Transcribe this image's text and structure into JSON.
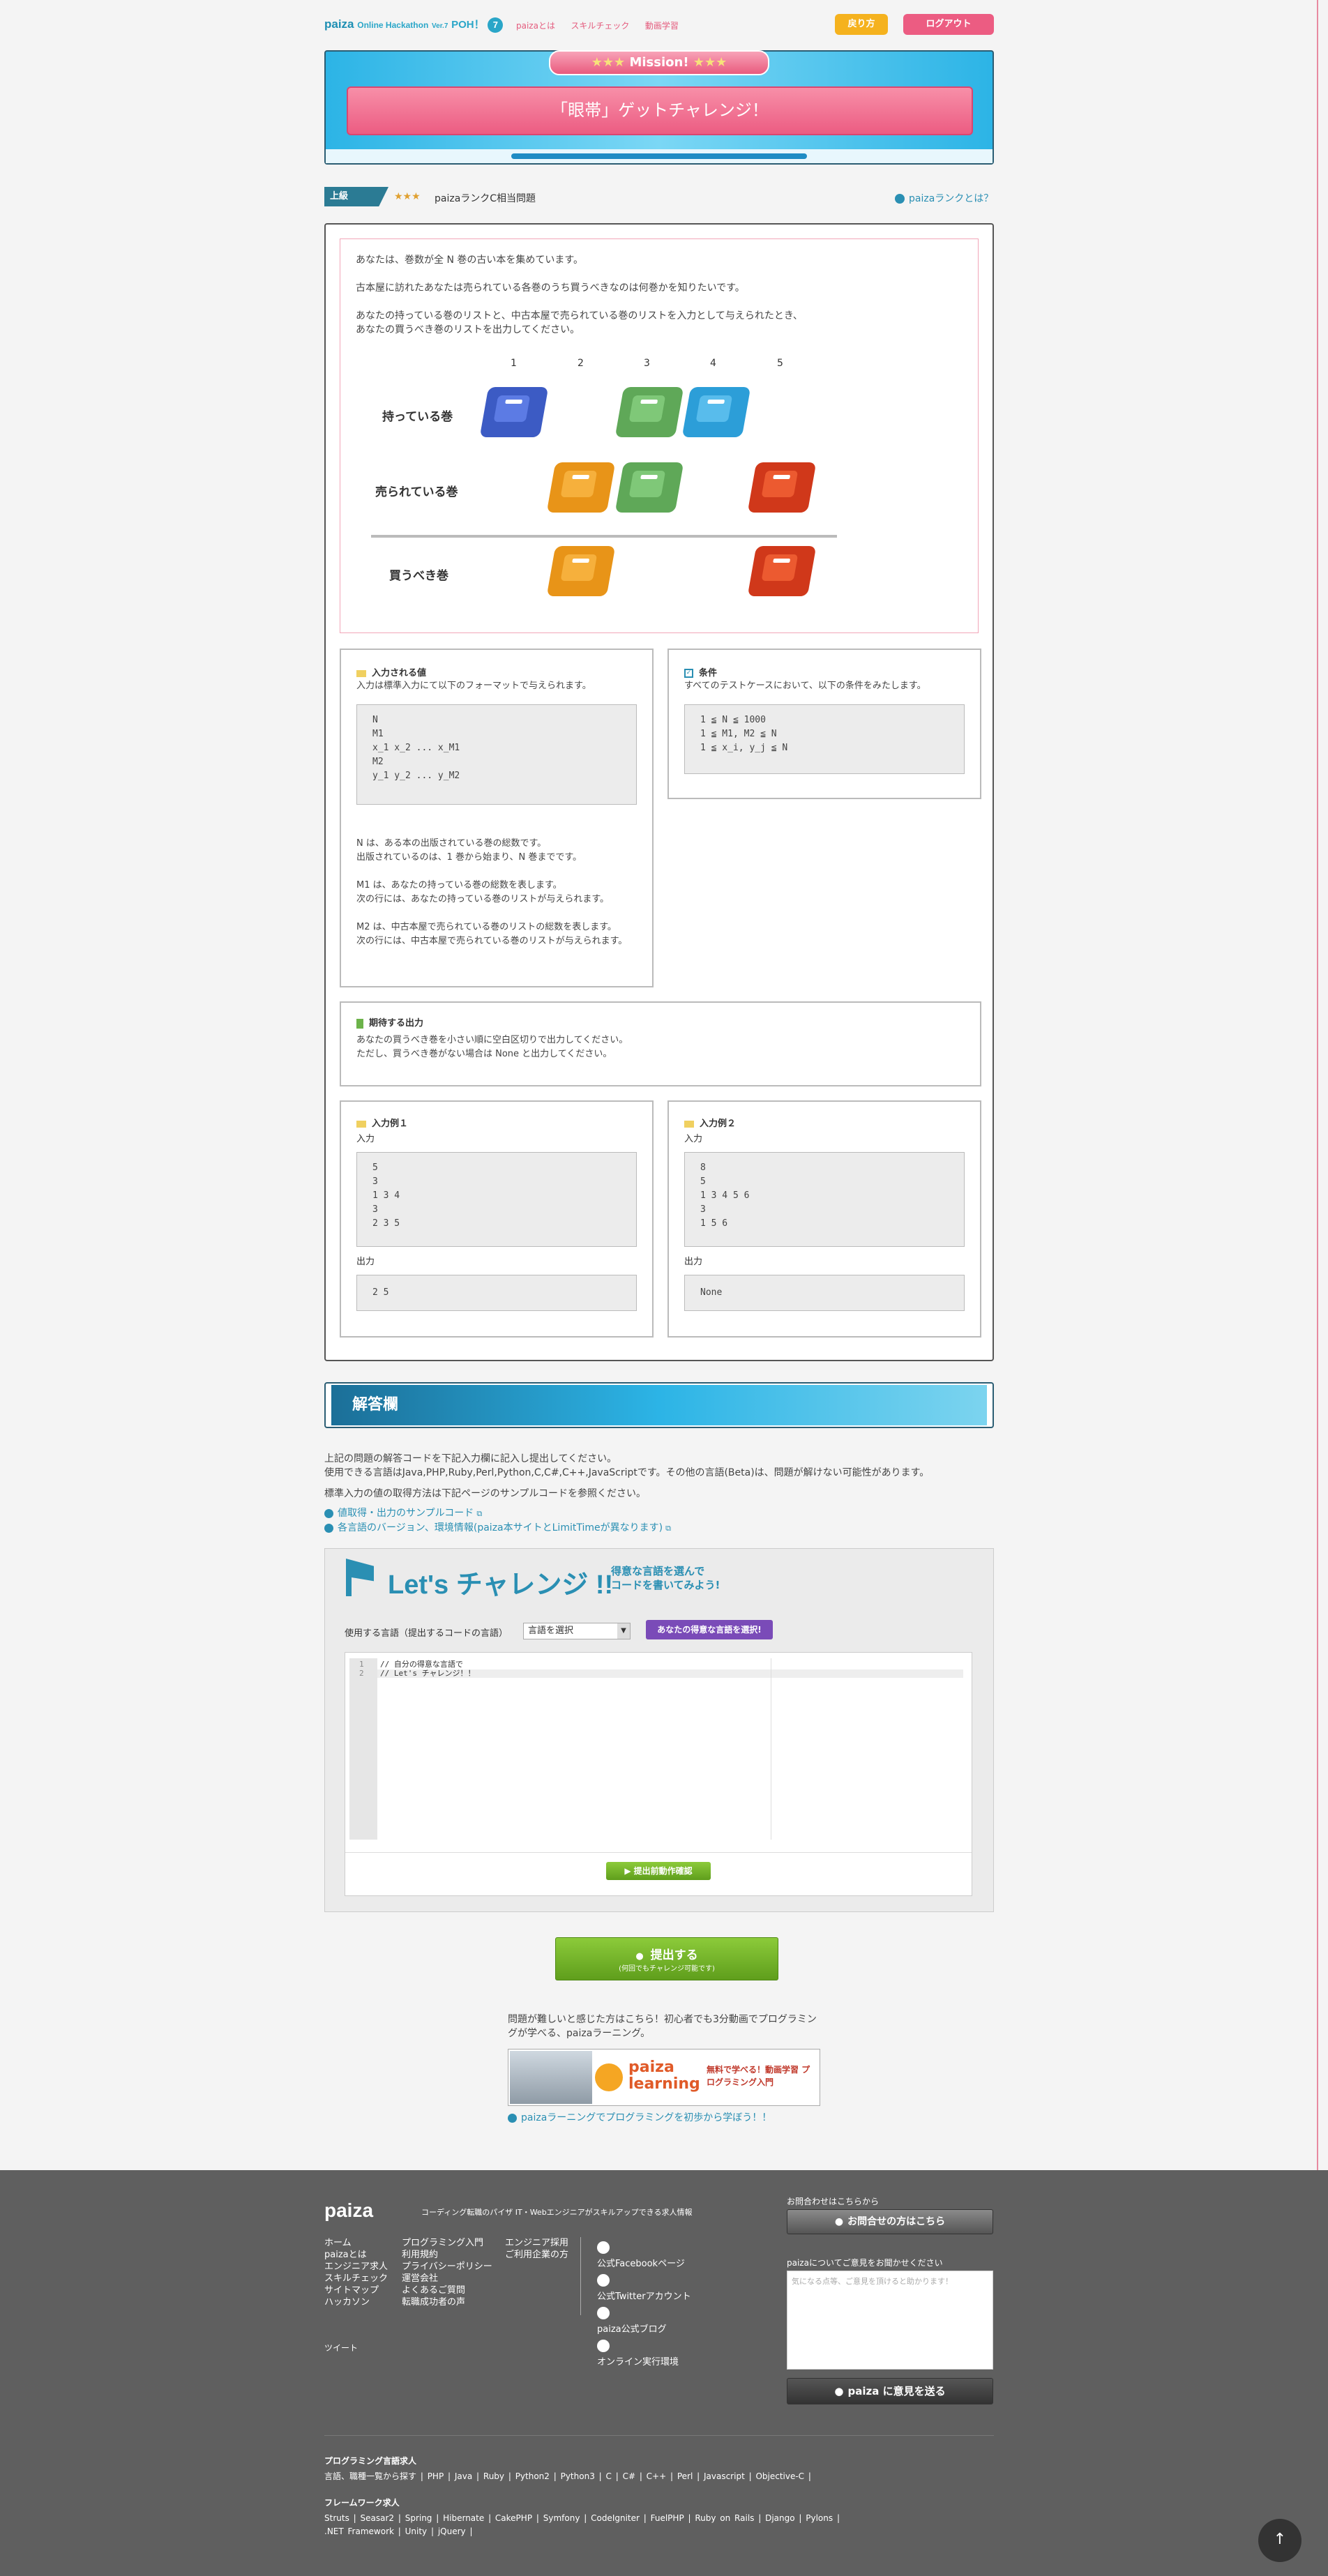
{
  "header": {
    "logo_main": "paiza",
    "logo_sub": "Online Hackathon",
    "logo_ver": "Ver.7",
    "logo_poh": "POH！",
    "logo_num": "7",
    "links": [
      "paizaとは",
      "スキルチェック",
      "動画学習"
    ],
    "btn_return": "戻り方",
    "btn_logout": "ログアウト"
  },
  "mission": {
    "label": "Mission!",
    "title": "「眼帯」ゲットチャレンジ！"
  },
  "rank": {
    "tag": "上級",
    "stars": "★★★",
    "desc": "paizaランクC相当問題",
    "about": "paizaランクとは？"
  },
  "problem": {
    "paragraphs": [
      "あなたは、巻数が全 N 巻の古い本を集めています。",
      "古本屋に訪れたあなたは売られている各巻のうち買うべきなのは何巻かを知りたいです。",
      "あなたの持っている巻のリストと、中古本屋で売られている巻のリストを入力として与えられたとき、",
      "あなたの買うべき巻のリストを出力してください。"
    ],
    "figure": {
      "numbers": [
        "1",
        "2",
        "3",
        "4",
        "5"
      ],
      "rows": [
        "持っている巻",
        "売られている巻",
        "買うべき巻"
      ]
    }
  },
  "input_section": {
    "title": "入力される値",
    "desc": "入力は標準入力にて以下のフォーマットで与えられます。",
    "format": "N\nM1\nx_1 x_2 ... x_M1\nM2\ny_1 y_2 ... y_M2",
    "notes": [
      "N は、ある本の出版されている巻の総数です。",
      "出版されているのは、1 巻から始まり、N 巻までです。",
      "M1 は、あなたの持っている巻の総数を表します。",
      "次の行には、あなたの持っている巻のリストが与えられます。",
      "M2 は、中古本屋で売られている巻のリストの総数を表します。",
      "次の行には、中古本屋で売られている巻のリストが与えられます。"
    ]
  },
  "conditions": {
    "title": "条件",
    "desc": "すべてのテストケースにおいて、以下の条件をみたします。",
    "list": "1 ≦ N ≦ 1000\n1 ≦ M1, M2 ≦ N\n1 ≦ x_i, y_j ≦ N"
  },
  "output_section": {
    "title": "期待する出力",
    "lines": [
      "あなたの買うべき巻を小さい順に空白区切りで出力してください。",
      "ただし、買うべき巻がない場合は None と出力してください。"
    ]
  },
  "example1": {
    "title": "入力例１",
    "in_label": "入力",
    "input": "5\n3\n1 3 4\n3\n2 3 5",
    "out_label": "出力",
    "output": "2 5"
  },
  "example2": {
    "title": "入力例２",
    "in_label": "入力",
    "input": "8\n5\n1 3 4 5 6\n3\n1 5 6",
    "out_label": "出力",
    "output": "None"
  },
  "answer": {
    "title": "解答欄",
    "lines": [
      "上記の問題の解答コードを下記入力欄に記入し提出してください。",
      "使用できる言語はJava,PHP,Ruby,Perl,Python,C,C#,C++,JavaScriptです。その他の言語(Beta)は、問題が解けない可能性があります。",
      "標準入力の値の取得方法は下記ページのサンプルコードを参照ください。"
    ],
    "links": [
      "値取得・出力のサンプルコード",
      "各言語のバージョン、環境情報(paiza本サイトとLimitTimeが異なります)"
    ],
    "lets": "Let's チャレンジ !!",
    "lets_sub1": "得意な言語を選んで",
    "lets_sub2": "コードを書いてみよう!",
    "lang_label": "使用する言語（提出するコードの言語）",
    "lang_select": "言語を選択",
    "lang_btn": "あなたの得意な言語を選択!",
    "code_lines": [
      {
        "n": "1",
        "t": "// 自分の得意な言語で"
      },
      {
        "n": "2",
        "t": "// Let's チャレンジ！！"
      }
    ],
    "check_btn": "提出前動作確認",
    "submit_btn": "提出する",
    "submit_sub": "(何回でもチャレンジ可能です)",
    "hint": "問題が難しいと感じた方はこちら！初心者でも3分動画でプログラミングが学べる、paizaラーニング。",
    "banner_logo": "paiza learning",
    "banner_text": "無料で学べる！動画学習 プログラミング入門",
    "learning_link": "paizaラーニングでプログラミングを初歩から学ぼう！！"
  },
  "footer": {
    "logo": "paiza",
    "tagline": "コーディング転職のパイザ IT・Webエンジニアがスキルアップできる求人情報",
    "col1": [
      "ホーム",
      "paizaとは",
      "エンジニア求人",
      "スキルチェック",
      "サイトマップ",
      "ハッカソン"
    ],
    "col2": [
      "プログラミング入門",
      "利用規約",
      "プライバシーポリシー",
      "運営会社",
      "よくあるご質問",
      "転職成功者の声"
    ],
    "col3": [
      "エンジニア採用",
      "ご利用企業の方"
    ],
    "social": [
      "公式Facebookページ",
      "公式Twitterアカウント",
      "paiza公式ブログ",
      "オンライン実行環境"
    ],
    "contact_label": "お問合わせはこちらから",
    "contact_btn": "お問合せの方はこちら",
    "opinion_label": "paizaについてご意見をお聞かせください",
    "opinion_placeholder": "気になる点等、ご意見を頂けると助かります！",
    "opinion_btn": "paiza に意見を送る",
    "tweet": "ツイート",
    "lang_head": "プログラミング言語求人",
    "langs": [
      "言語、職種一覧から探す",
      "PHP",
      "Java",
      "Ruby",
      "Python2",
      "Python3",
      "C",
      "C#",
      "C++",
      "Perl",
      "Javascript",
      "Objective-C"
    ],
    "fw_head": "フレームワーク求人",
    "fws": [
      "Struts",
      "Seasar2",
      "Spring",
      "Hibernate",
      "CakePHP",
      "Symfony",
      "CodeIgniter",
      "FuelPHP",
      "Ruby on Rails",
      "Django",
      "Pylons",
      ".NET Framework",
      "Unity",
      "jQuery"
    ]
  }
}
